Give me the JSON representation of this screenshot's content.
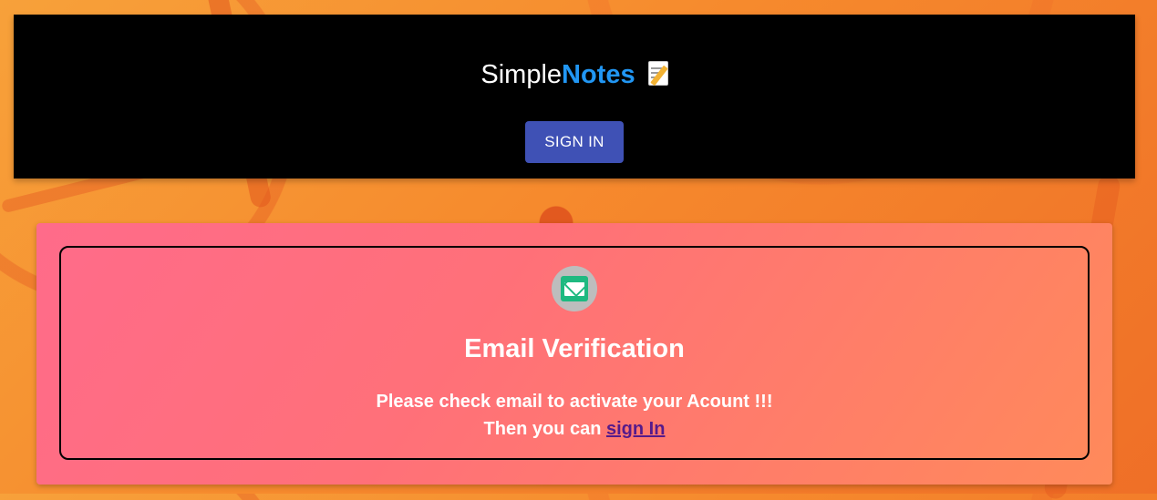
{
  "header": {
    "brand_prefix": "Simple",
    "brand_accent": "Notes",
    "brand_icon": "memo-icon",
    "signin_label": "SIGN IN"
  },
  "verification": {
    "icon": "mail-icon",
    "title": "Email Verification",
    "message_line1": "Please check email to activate your Acount !!!",
    "message_line2_prefix": "Then you can ",
    "signin_link": "sign In"
  },
  "colors": {
    "header_bg": "#000000",
    "brand_accent": "#2196f3",
    "button_bg": "#3f51b5",
    "card_gradient_start": "#ff6b8a",
    "card_gradient_end": "#ff8a5a",
    "mail_icon": "#1eb980",
    "link": "#551a8b"
  }
}
